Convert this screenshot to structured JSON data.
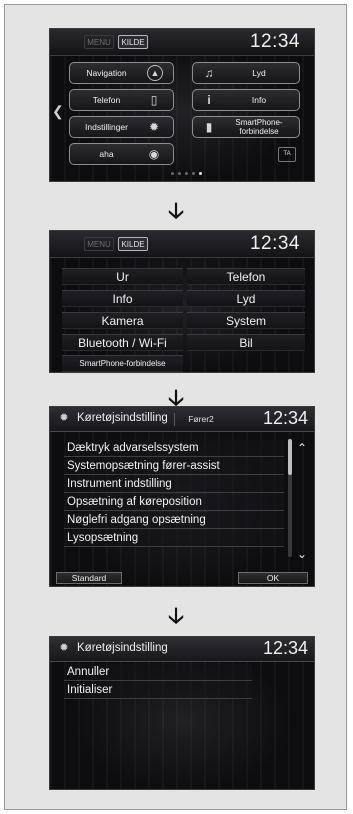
{
  "screen1": {
    "tabs": {
      "menu": "MENU",
      "source": "KILDE"
    },
    "clock": "12:34",
    "left_buttons": [
      {
        "label": "Navigation",
        "icon": "compass-icon"
      },
      {
        "label": "Telefon",
        "icon": "phone-icon"
      },
      {
        "label": "Indstillinger",
        "icon": "gear-icon"
      },
      {
        "label": "aha",
        "icon": "aha-icon"
      }
    ],
    "right_buttons": [
      {
        "label": "Lyd",
        "icon": "music-note-icon"
      },
      {
        "label": "Info",
        "icon": "info-icon"
      },
      {
        "label_line1": "SmartPhone-",
        "label_line2": "forbindelse",
        "icon": "smartphone-icon"
      }
    ],
    "ta_badge": "TA",
    "page_indicator": {
      "pages": 5,
      "current": 5
    }
  },
  "screen2": {
    "tabs": {
      "menu": "MENU",
      "source": "KILDE"
    },
    "clock": "12:34",
    "grid": [
      [
        "Ur",
        "Telefon"
      ],
      [
        "Info",
        "Lyd"
      ],
      [
        "Kamera",
        "System"
      ],
      [
        "Bluetooth / Wi-Fi",
        "Bil"
      ]
    ],
    "smartphone_button": "SmartPhone-forbindelse"
  },
  "screen3": {
    "title": "Køretøjsindstilling",
    "user": "Fører2",
    "clock": "12:34",
    "items": [
      "Dæktryk advarselssystem",
      "Systemopsætning fører-assist",
      "Instrument indstilling",
      "Opsætning af køreposition",
      "Nøglefri adgang opsætning",
      "Lysopsætning"
    ],
    "buttons": {
      "default": "Standard",
      "ok": "OK"
    }
  },
  "screen4": {
    "title": "Køretøjsindstilling",
    "clock": "12:34",
    "items": [
      "Annuller",
      "Initialiser"
    ]
  },
  "colors": {
    "screen_bg": "#0d0d0f",
    "text": "#f2f2f2",
    "frame_bg": "#e4e4e4"
  }
}
